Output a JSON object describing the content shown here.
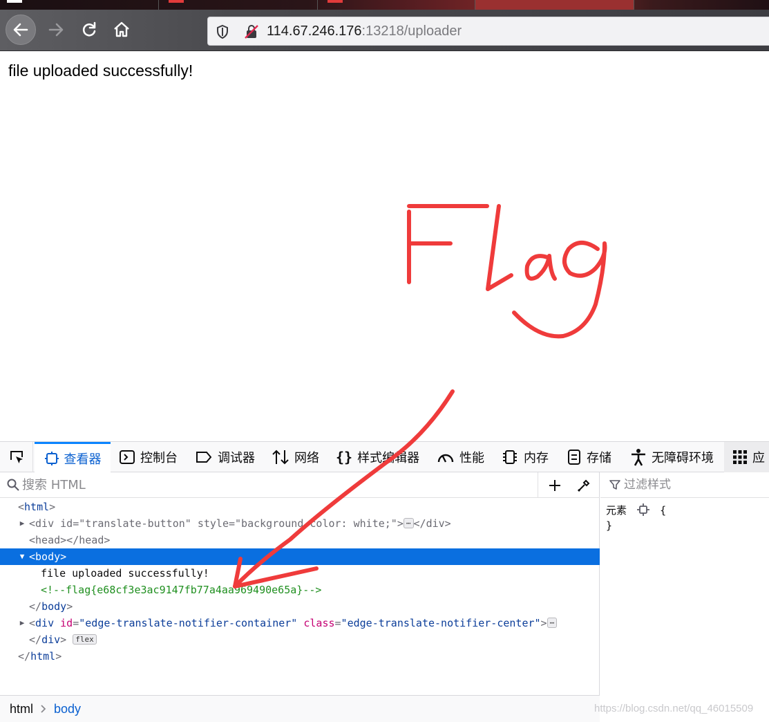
{
  "browser": {
    "url_host": "114.67.246.176",
    "url_rest": ":13218/uploader"
  },
  "page": {
    "message": "file uploaded successfully!"
  },
  "annotation": {
    "text": "Flag",
    "color": "#ef3b3b"
  },
  "devtools": {
    "tabs": [
      {
        "label": "查看器",
        "icon": "inspector-icon",
        "active": true
      },
      {
        "label": "控制台",
        "icon": "console-icon"
      },
      {
        "label": "调试器",
        "icon": "debugger-icon"
      },
      {
        "label": "网络",
        "icon": "network-icon"
      },
      {
        "label": "样式编辑器",
        "icon": "style-editor-icon"
      },
      {
        "label": "性能",
        "icon": "performance-icon"
      },
      {
        "label": "内存",
        "icon": "memory-icon"
      },
      {
        "label": "存储",
        "icon": "storage-icon"
      },
      {
        "label": "无障碍环境",
        "icon": "accessibility-icon"
      },
      {
        "label": "应",
        "icon": "application-icon"
      }
    ],
    "search_placeholder": "搜索 HTML",
    "filter_placeholder": "过滤样式",
    "markup": {
      "html_open": "html",
      "div_translate_tag": "div",
      "div_translate_id_attr": "id",
      "div_translate_id_val": "\"translate-button\"",
      "div_translate_style_attr": "style",
      "div_translate_style_val": "\"background-color: white;\"",
      "head_line": "<head></head>",
      "body_open": "body",
      "text_node": "file uploaded successfully!",
      "comment": "<!--flag{e68cf3e3ac9147fb77a4aa969490e65a}-->",
      "body_close": "body",
      "div_notifier_tag": "div",
      "div_notifier_id_attr": "id",
      "div_notifier_id_val": "\"edge-translate-notifier-container\"",
      "div_notifier_class_attr": "class",
      "div_notifier_class_val": "\"edge-translate-notifier-center\"",
      "div_close": "div",
      "flex_badge": "flex",
      "ellipsis_badge": "⋯",
      "html_close": "html"
    },
    "rules": {
      "element_label": "元素",
      "open_brace": "{",
      "close_brace": "}"
    },
    "breadcrumb": [
      "html",
      "body"
    ]
  },
  "watermark": "https://blog.csdn.net/qq_46015509"
}
